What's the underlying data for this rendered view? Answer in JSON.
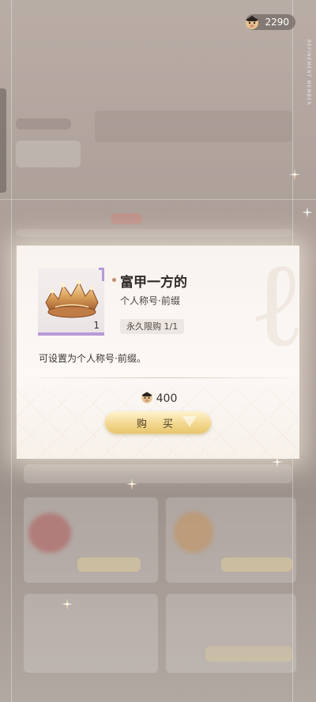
{
  "header": {
    "currency_amount": "2290",
    "currency_icon": "pig-mascot-coin-icon",
    "side_vertical_text": "REFINEMENT MEMBER"
  },
  "modal": {
    "item": {
      "name": "富甲一方的",
      "type": "个人称号·前缀",
      "quantity": "1",
      "limit": "永久限购 1/1",
      "rarity_color": "#b89ad8",
      "icon": "golden-crown-icon"
    },
    "description": "可设置为个人称号·前缀。",
    "price": {
      "amount": "400",
      "currency_icon": "pig-mascot-coin-icon"
    },
    "buy_label": "购 买",
    "accent_color": "#e8c66c"
  }
}
